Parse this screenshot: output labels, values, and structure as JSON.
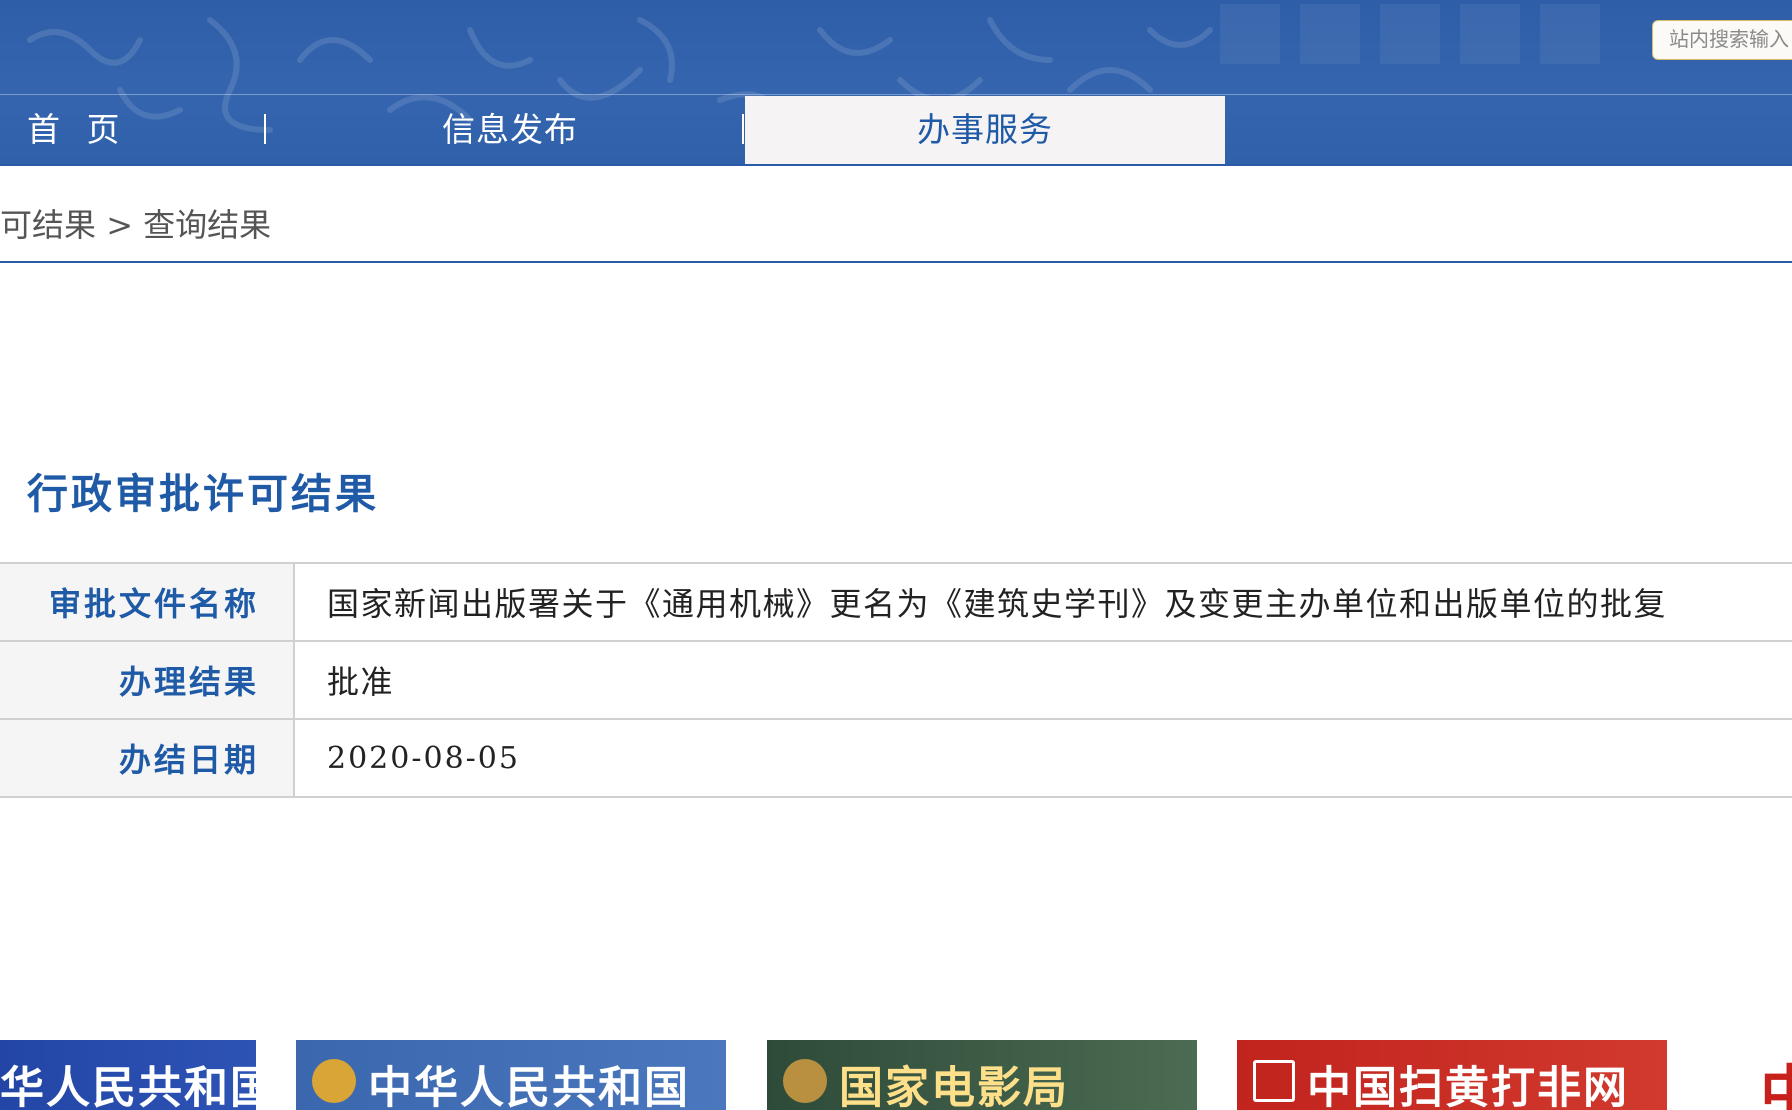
{
  "header": {
    "search_placeholder": "站内搜索输入",
    "nav": {
      "home": "首 页",
      "info": "信息发布",
      "services": "办事服务"
    }
  },
  "breadcrumb": {
    "parent": "可结果",
    "separator": ">",
    "current": "查询结果"
  },
  "main": {
    "title": "行政审批许可结果",
    "rows": [
      {
        "label": "审批文件名称",
        "value": "国家新闻出版署关于《通用机械》更名为《建筑史学刊》及变更主办单位和出版单位的批复"
      },
      {
        "label": "办理结果",
        "value": "批准"
      },
      {
        "label": "办结日期",
        "value": "2020-08-05"
      }
    ]
  },
  "banners": {
    "b1": "华人民共和国",
    "b2": "中华人民共和国",
    "b3": "国家电影局",
    "b4": "中国扫黄打非网",
    "b5": "中"
  },
  "colors": {
    "header_blue": "#2f60aa",
    "accent_blue": "#1f5aa6",
    "nav_active_bg": "#f5f3f4"
  }
}
